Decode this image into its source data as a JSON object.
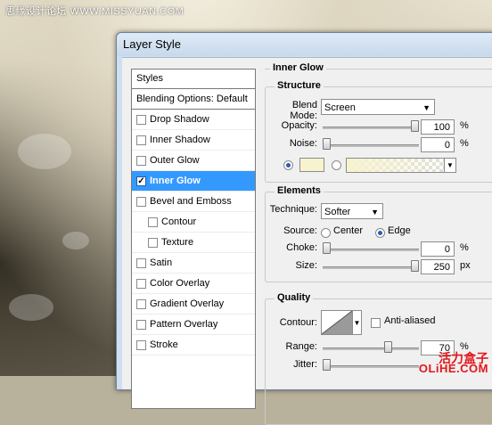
{
  "watermark": "思缘设计论坛 WWW.MISSYUAN.COM",
  "dialog": {
    "title": "Layer Style"
  },
  "styles_list": {
    "header": "Styles",
    "blending_options": "Blending Options: Default",
    "items": [
      {
        "label": "Drop Shadow",
        "checked": false,
        "selected": false,
        "indent": false
      },
      {
        "label": "Inner Shadow",
        "checked": false,
        "selected": false,
        "indent": false
      },
      {
        "label": "Outer Glow",
        "checked": false,
        "selected": false,
        "indent": false
      },
      {
        "label": "Inner Glow",
        "checked": true,
        "selected": true,
        "indent": false
      },
      {
        "label": "Bevel and Emboss",
        "checked": false,
        "selected": false,
        "indent": false
      },
      {
        "label": "Contour",
        "checked": false,
        "selected": false,
        "indent": true
      },
      {
        "label": "Texture",
        "checked": false,
        "selected": false,
        "indent": true
      },
      {
        "label": "Satin",
        "checked": false,
        "selected": false,
        "indent": false
      },
      {
        "label": "Color Overlay",
        "checked": false,
        "selected": false,
        "indent": false
      },
      {
        "label": "Gradient Overlay",
        "checked": false,
        "selected": false,
        "indent": false
      },
      {
        "label": "Pattern Overlay",
        "checked": false,
        "selected": false,
        "indent": false
      },
      {
        "label": "Stroke",
        "checked": false,
        "selected": false,
        "indent": false
      }
    ]
  },
  "inner_glow": {
    "title": "Inner Glow",
    "structure": {
      "title": "Structure",
      "blend_mode_label": "Blend Mode:",
      "blend_mode_value": "Screen",
      "opacity_label": "Opacity:",
      "opacity_value": "100",
      "opacity_fraction": 1.0,
      "noise_label": "Noise:",
      "noise_value": "0",
      "noise_fraction": 0.0,
      "percent": "%",
      "glow_color": "#f7f3cf"
    },
    "elements": {
      "title": "Elements",
      "technique_label": "Technique:",
      "technique_value": "Softer",
      "source_label": "Source:",
      "source_center": "Center",
      "source_edge": "Edge",
      "choke_label": "Choke:",
      "choke_value": "0",
      "choke_fraction": 0.0,
      "size_label": "Size:",
      "size_value": "250",
      "size_fraction": 1.0,
      "percent": "%",
      "px": "px"
    },
    "quality": {
      "title": "Quality",
      "contour_label": "Contour:",
      "anti_aliased_label": "Anti-aliased",
      "range_label": "Range:",
      "range_value": "70",
      "range_fraction": 0.7,
      "jitter_label": "Jitter:",
      "jitter_fraction": 0.0,
      "percent": "%"
    }
  },
  "logo": {
    "cn": "活力盒子",
    "en": "OLiHE.COM"
  },
  "colors": {
    "selection": "#3399ff",
    "glow": "#f7f3cf"
  }
}
